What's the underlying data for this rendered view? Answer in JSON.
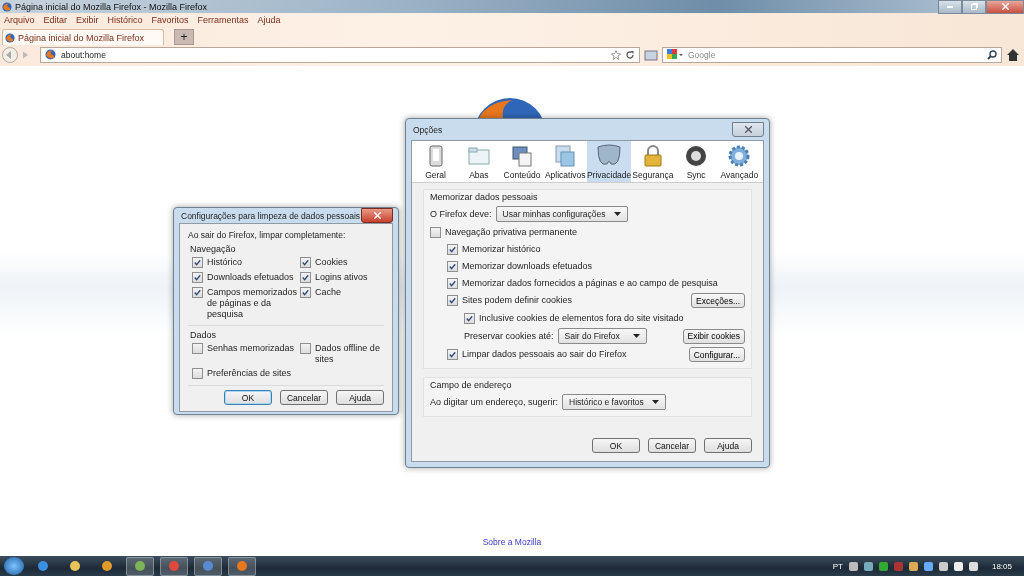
{
  "browser": {
    "title": "Página inicial do Mozilla Firefox - Mozilla Firefox",
    "menu": [
      "Arquivo",
      "Editar",
      "Exibir",
      "Histórico",
      "Favoritos",
      "Ferramentas",
      "Ajuda"
    ],
    "tabs": [
      {
        "label": "Página inicial do Mozilla Firefox",
        "selected": true
      }
    ],
    "new_tab": "+",
    "address": "about:home",
    "search_placeholder": "Google"
  },
  "page": {
    "footer_link": "Sobre a Mozilla"
  },
  "clear_dialog": {
    "title": "Configurações para limpeza de dados pessoais",
    "heading": "Ao sair do Firefox, limpar completamente:",
    "sections": [
      {
        "title": "Navegação",
        "items": [
          {
            "label": "Histórico",
            "checked": true
          },
          {
            "label": "Cookies",
            "checked": true
          },
          {
            "label": "Downloads efetuados",
            "checked": true
          },
          {
            "label": "Logins ativos",
            "checked": true
          },
          {
            "label": "Campos memorizados de páginas e da pesquisa",
            "checked": true
          },
          {
            "label": "Cache",
            "checked": true
          }
        ]
      },
      {
        "title": "Dados",
        "items": [
          {
            "label": "Senhas memorizadas",
            "checked": false
          },
          {
            "label": "Dados offline de sites",
            "checked": false
          },
          {
            "label": "Preferências de sites",
            "checked": false
          }
        ]
      }
    ],
    "buttons": [
      {
        "label": "OK",
        "default": true
      },
      {
        "label": "Cancelar",
        "default": false
      },
      {
        "label": "Ajuda",
        "default": false
      }
    ]
  },
  "options_dialog": {
    "title": "Opções",
    "tabs": [
      {
        "label": "Geral",
        "selected": false
      },
      {
        "label": "Abas",
        "selected": false
      },
      {
        "label": "Conteúdo",
        "selected": false
      },
      {
        "label": "Aplicativos",
        "selected": false
      },
      {
        "label": "Privacidade",
        "selected": true
      },
      {
        "label": "Segurança",
        "selected": false
      },
      {
        "label": "Sync",
        "selected": false
      },
      {
        "label": "Avançado",
        "selected": false
      }
    ],
    "groups": [
      {
        "title": "Memorizar dados pessoais",
        "rows": [
          {
            "kind": "select",
            "label": "O Firefox deve:",
            "value": "Usar minhas configurações"
          },
          {
            "kind": "checkbox",
            "label": "Navegação privativa permanente",
            "checked": false,
            "children": [
              {
                "kind": "checkbox",
                "label": "Memorizar histórico",
                "checked": true
              },
              {
                "kind": "checkbox",
                "label": "Memorizar downloads efetuados",
                "checked": true
              },
              {
                "kind": "checkbox",
                "label": "Memorizar dados fornecidos a páginas e ao campo de pesquisa",
                "checked": true
              },
              {
                "kind": "checkbox",
                "label": "Sites podem definir cookies",
                "checked": true,
                "button": "Exceções...",
                "children": [
                  {
                    "kind": "checkbox",
                    "label": "Inclusive cookies de elementos fora do site visitado",
                    "checked": true
                  },
                  {
                    "kind": "select",
                    "label": "Preservar cookies até:",
                    "value": "Sair do Firefox",
                    "button": "Exibir cookies"
                  }
                ]
              },
              {
                "kind": "checkbox",
                "label": "Limpar dados pessoais ao sair do Firefox",
                "checked": true,
                "button": "Configurar..."
              }
            ]
          }
        ]
      },
      {
        "title": "Campo de endereço",
        "rows": [
          {
            "kind": "select",
            "label": "Ao digitar um endereço, sugerir:",
            "value": "Histórico e favoritos"
          }
        ]
      }
    ],
    "buttons": [
      {
        "label": "OK"
      },
      {
        "label": "Cancelar"
      },
      {
        "label": "Ajuda"
      }
    ]
  },
  "taskbar": {
    "language": "PT",
    "time": "18:05"
  }
}
